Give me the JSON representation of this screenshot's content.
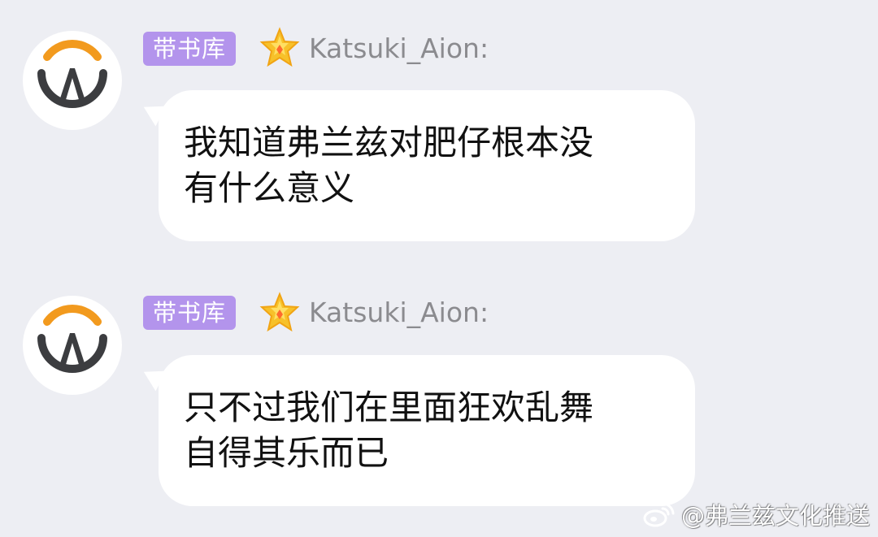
{
  "messages": [
    {
      "badge": "带书库",
      "username": "Katsuki_Aion:",
      "text": "我知道弗兰兹对肥仔根本没\n有什么意义"
    },
    {
      "badge": "带书库",
      "username": "Katsuki_Aion:",
      "text": "只不过我们在里面狂欢乱舞\n自得其乐而已"
    }
  ],
  "watermark": {
    "text": "@弗兰兹文化推送"
  },
  "icons": {
    "avatar": "overwatch-logo-icon",
    "badge_star": "star-icon",
    "watermark": "weibo-icon"
  },
  "colors": {
    "background": "#edeef3",
    "badge": "#b394ec",
    "star": "#f7c12a",
    "avatar_orange": "#f29a1e",
    "avatar_dark": "#3c3d40",
    "username": "#8b8b8f"
  }
}
